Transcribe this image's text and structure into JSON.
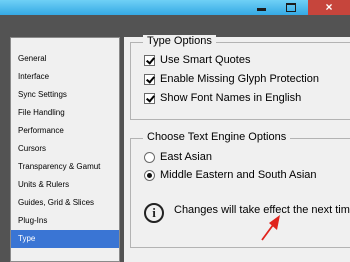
{
  "window": {
    "close_glyph": "×",
    "close_color": "#c6453c",
    "titlebar_color": "#35a9e4"
  },
  "sidebar": {
    "items": [
      {
        "label": "General"
      },
      {
        "label": "Interface"
      },
      {
        "label": "Sync Settings"
      },
      {
        "label": "File Handling"
      },
      {
        "label": "Performance"
      },
      {
        "label": "Cursors"
      },
      {
        "label": "Transparency & Gamut"
      },
      {
        "label": "Units & Rulers"
      },
      {
        "label": "Guides, Grid & Slices"
      },
      {
        "label": "Plug-Ins"
      },
      {
        "label": "Type",
        "selected": true
      }
    ],
    "selected_color": "#3a75d4"
  },
  "type_options": {
    "title": "Type Options",
    "use_smart_quotes": "Use Smart Quotes",
    "enable_missing_glyph": "Enable Missing Glyph Protection",
    "show_font_names": "Show Font Names in English"
  },
  "text_engine": {
    "title": "Choose Text Engine Options",
    "east_asian": "East Asian",
    "middle_eastern": "Middle Eastern and South Asian",
    "selected": "middle_eastern",
    "info_glyph": "i",
    "info_text": "Changes will take effect the next time y"
  },
  "annotation": {
    "arrow_color": "#e0231c",
    "arrow_icon": "red-arrow-icon"
  }
}
